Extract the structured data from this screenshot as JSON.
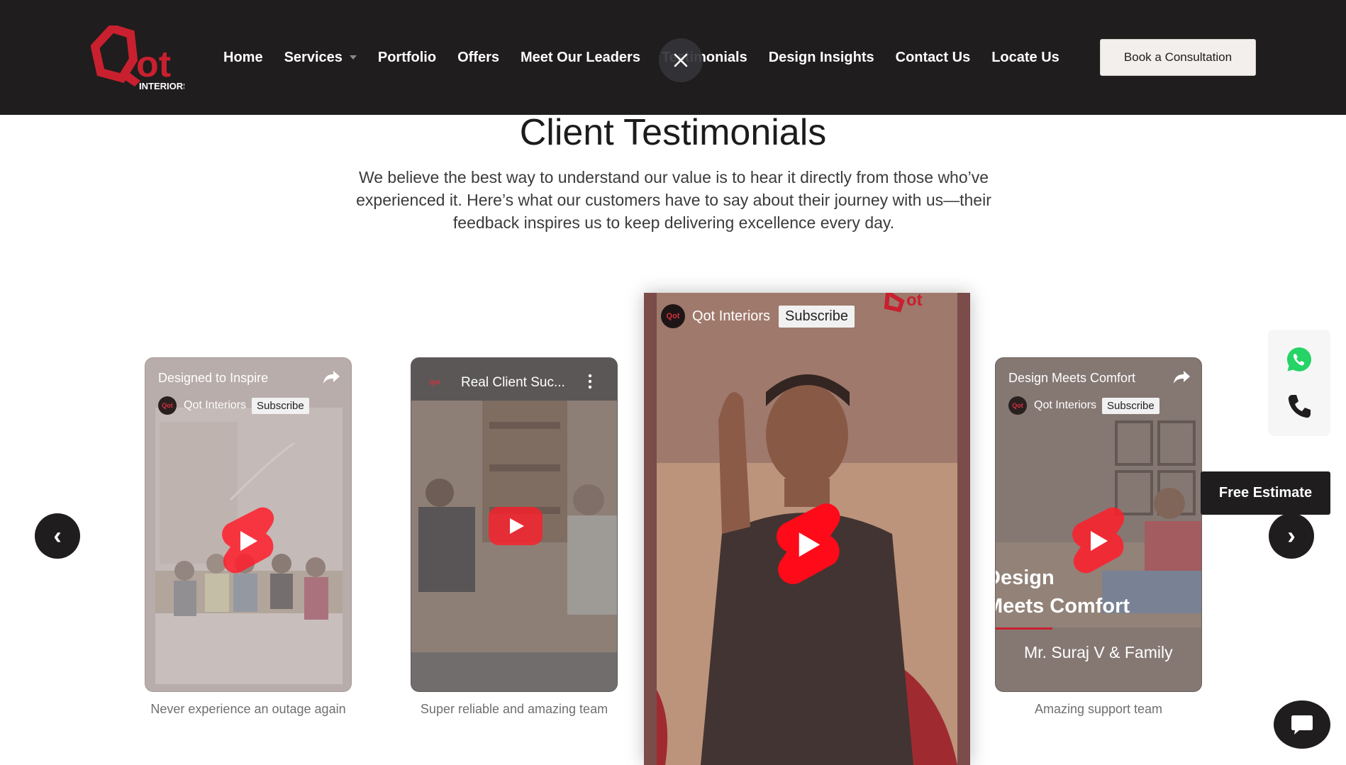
{
  "brand": {
    "logo_letters": "Qot",
    "logo_sub": "INTERIORS",
    "accent_color": "#c8202f",
    "dark_color": "#1f1d1d"
  },
  "nav": {
    "items": [
      {
        "label": "Home"
      },
      {
        "label": "Services"
      },
      {
        "label": "Portfolio"
      },
      {
        "label": "Offers"
      },
      {
        "label": "Meet Our Leaders"
      },
      {
        "label": "Testimonials"
      },
      {
        "label": "Design Insights"
      },
      {
        "label": "Contact Us"
      },
      {
        "label": "Locate Us"
      }
    ],
    "cta": "Book a Consultation"
  },
  "section": {
    "title": "Client Testimonials",
    "intro": "We believe the best way to understand our value is to hear it directly from those who’ve experienced it. Here’s what our customers have to say about their journey with us—their feedback inspires us to keep delivering excellence every day."
  },
  "videos": [
    {
      "top_title": "Designed to Inspire",
      "channel": "Qot Interiors",
      "subscribe": "Subscribe",
      "caption": "Never experience an outage again",
      "icon": "share-icon"
    },
    {
      "top_title": "Real Client Suc...",
      "caption": "Super reliable and amazing team",
      "icon": "more-vert-icon"
    },
    {
      "channel": "Qot Interiors",
      "subscribe": "Subscribe"
    },
    {
      "top_title": "Design Meets Comfort",
      "channel": "Qot Interiors",
      "subscribe": "Subscribe",
      "overlay_line1": "Design",
      "overlay_line2": "Meets Comfort",
      "overlay_name": "Mr. Suraj V & Family",
      "caption": "Amazing support team",
      "icon": "share-icon"
    }
  ],
  "controls": {
    "prev": "‹",
    "next": "›",
    "free_estimate": "Free Estimate"
  }
}
